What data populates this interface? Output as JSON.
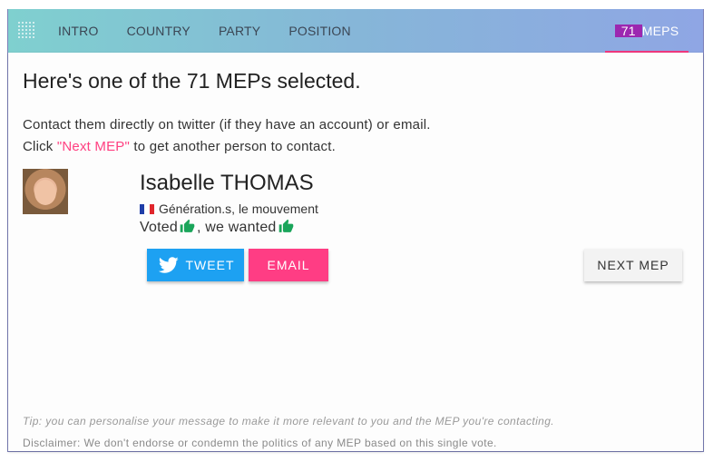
{
  "nav": {
    "logo_icon": "dot-grid-logo-icon",
    "items": [
      "INTRO",
      "COUNTRY",
      "PARTY",
      "POSITION"
    ],
    "meps_count": "71",
    "meps_label": "MEPS"
  },
  "colors": {
    "accent": "#ff4081",
    "twitter": "#1da1f2",
    "email": "#ff3d84",
    "badge": "#9c27b0",
    "thumb": "#1aa55a"
  },
  "main": {
    "heading": "Here's one of the 71 MEPs selected.",
    "line1": "Contact them directly on twitter (if they have an account) or email.",
    "line2_prefix": "Click ",
    "line2_link": "\"Next MEP\"",
    "line2_suffix": " to get another person to contact."
  },
  "mep": {
    "name": "Isabelle THOMAS",
    "flag_icon": "france-flag-icon",
    "party": "Génération.s, le mouvement",
    "voted_label": "Voted",
    "wanted_label": ", we wanted",
    "voted_icon": "thumbs-up-icon",
    "wanted_icon": "thumbs-up-icon"
  },
  "buttons": {
    "tweet": "TWEET",
    "email": "EMAIL",
    "next": "NEXT MEP"
  },
  "footer": {
    "tip": "Tip: you can personalise your message to make it more relevant to you and the MEP you're contacting.",
    "disclaimer": "Disclaimer: We don't endorse or condemn the politics of any MEP based on this single vote."
  }
}
